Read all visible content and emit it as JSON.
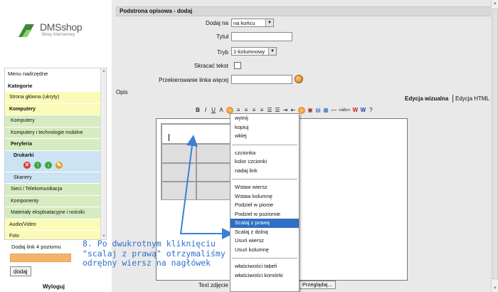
{
  "brand": {
    "name": "DMSshop",
    "tagline": "Sklep internetowy"
  },
  "sidebar": {
    "menu_items": [
      {
        "label": "Menu nadrzędne",
        "kind": "hdr"
      },
      {
        "label": "Kategorie",
        "kind": "hdr bold"
      },
      {
        "label": "Strona główna",
        "hint": "(ukryty)",
        "kind": "lvl1"
      },
      {
        "label": "Komputery",
        "kind": "lvl1 bold"
      },
      {
        "label": "Komputery",
        "kind": "lvl2"
      },
      {
        "label": "Komputery i technologie mobilne",
        "kind": "lvl2"
      },
      {
        "label": "Peryferia",
        "kind": "lvl2 bold"
      },
      {
        "label": "Drukarki",
        "kind": "lvl3 bold tall",
        "actions": true
      },
      {
        "label": "Skanery",
        "kind": "lvl3"
      },
      {
        "label": "Sieci i Telekomunikacja",
        "kind": "lvl2"
      },
      {
        "label": "Komponenty",
        "kind": "lvl2"
      },
      {
        "label": "Materiały eksploatacyjne i nośniki",
        "kind": "lvl2"
      },
      {
        "label": "Audio/Video",
        "kind": "lvl1"
      },
      {
        "label": "Foto",
        "kind": "lvl1"
      }
    ],
    "add_label": "Dodaj link 4 poziomu",
    "add_button": "dodaj",
    "logout": "Wyloguj"
  },
  "main": {
    "title": "Podstrona opisowa - dodaj",
    "form": {
      "add_on_label": "Dodaj na",
      "add_on_value": "na końcu",
      "title_label": "Tytuł",
      "title_value": "",
      "mode_label": "Tryb",
      "mode_value": "1-kolumnowy",
      "shorten_label": "Skracać tekst",
      "redirect_label": "Przekierowanie linka więcej",
      "redirect_value": "",
      "desc_label": "Opis",
      "image_text_label": "Text zdjęcie",
      "browse_button": "Przeglądaj..."
    },
    "tabs": {
      "visual": "Edycja wizualna",
      "html": "Edycja HTML"
    },
    "toolbar": [
      "B",
      "I",
      "U",
      "A",
      "«abc»"
    ]
  },
  "context_menu": {
    "groups": [
      [
        "wytnij",
        "kopiuj",
        "wklej"
      ],
      [
        "czcionka",
        "kolor czcionki",
        "nadaj link"
      ],
      [
        "Wstaw wiersz",
        "Wstaw kolumnę",
        "Podziel w pionie",
        "Podziel w poziomie",
        "Scalaj z prawą",
        "Scalaj z dolną",
        "Usuń wiersz",
        "Usuń kolumnę"
      ],
      [
        "właściwości tabeli",
        "właściwości komórki"
      ]
    ],
    "active_item": "Scalaj z prawą"
  },
  "caption": {
    "line1": "8. Po dwukrotnym kliknięciu",
    "line2": "\"scalaj z prawą\" otrzymaliśmy",
    "line3": "odrębny wiersz na nagłówek"
  },
  "colors": {
    "annotation": "#2d6fd0",
    "menu_highlight": "#2f6fc4",
    "level1": "#fbfbb8",
    "level2": "#d6ecc0",
    "level3": "#cbe3f2"
  }
}
